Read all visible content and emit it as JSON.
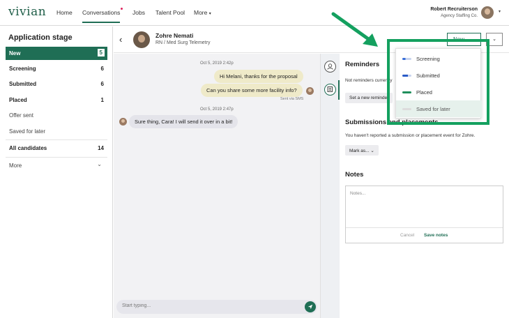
{
  "nav": {
    "logo": "vivian",
    "items": [
      {
        "label": "Home"
      },
      {
        "label": "Conversations"
      },
      {
        "label": "Jobs"
      },
      {
        "label": "Talent Pool"
      },
      {
        "label": "More"
      }
    ],
    "more_caret": "▾",
    "user_name": "Robert Recruiterson",
    "user_company": "Agency Staffing Co.",
    "user_caret": "▾"
  },
  "sidebar": {
    "title": "Application stage",
    "stages": [
      {
        "label": "New",
        "count": "5"
      },
      {
        "label": "Screening",
        "count": "6"
      },
      {
        "label": "Submitted",
        "count": "6"
      },
      {
        "label": "Placed",
        "count": "1"
      },
      {
        "label": "Offer sent",
        "count": ""
      },
      {
        "label": "Saved for later",
        "count": ""
      }
    ],
    "all_candidates": {
      "label": "All candidates",
      "count": "14"
    },
    "more": "More",
    "more_chevron": "⌄"
  },
  "conversation": {
    "back_glyph": "‹",
    "name": "Zohre Nemati",
    "subtitle": "RN / Med Surg Telemetry",
    "new_button": "New",
    "new_chevron": "⌄",
    "more_chevron": "⌄",
    "messages": [
      {
        "timestamp": "Oct 5, 2019 2:42p"
      },
      {
        "text": "Hi Melani, thanks for the proposal"
      },
      {
        "text": "Can you share some more facility info?"
      },
      {
        "sent_via": "Sent via SMS"
      },
      {
        "timestamp": "Oct 5, 2019 2:47p"
      },
      {
        "text": "Sure thing, Cara! I will send it over in a bit!"
      }
    ],
    "compose_placeholder": "Start typing..."
  },
  "panel": {
    "reminders_title": "Reminders",
    "reminders_text": "Not reminders currently",
    "set_reminder": "Set a new reminder",
    "submissions_title": "Submissions and placements",
    "submissions_text": "You haven't reported a submission or placement event for Zohre.",
    "mark_as": "Mark as...",
    "mark_chevron": "⌄",
    "notes_title": "Notes",
    "notes_placeholder": "Notes...",
    "cancel": "Cancel",
    "save_notes": "Save notes"
  },
  "dropdown": {
    "items": [
      {
        "label": "Screening"
      },
      {
        "label": "Submitted"
      },
      {
        "label": "Placed"
      },
      {
        "label": "Saved for later"
      }
    ]
  },
  "colors": {
    "brand_green": "#1f6e55",
    "annotation_green": "#14a05f",
    "notification_dot": "#e0245e",
    "screening_indicator": "#3a6fd8",
    "submitted_indicator": "#2a5bc7",
    "placed_indicator": "#1f8f5c"
  }
}
